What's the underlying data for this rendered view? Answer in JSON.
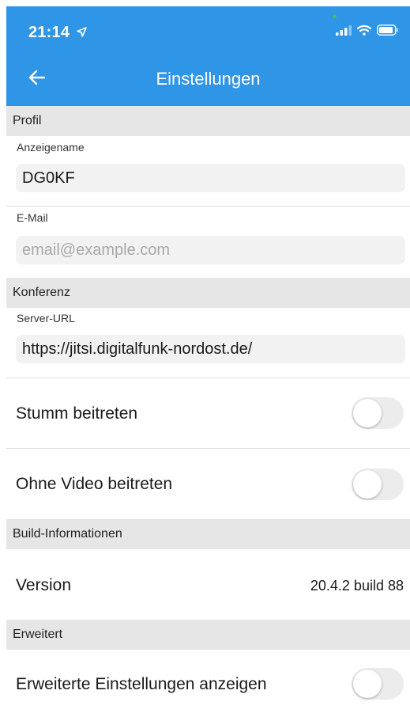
{
  "status_bar": {
    "time": "21:14",
    "icons": [
      "location-arrow-icon",
      "signal-icon",
      "wifi-icon",
      "battery-icon"
    ]
  },
  "nav": {
    "title": "Einstellungen",
    "back_icon": "arrow-left-icon"
  },
  "sections": {
    "profil": {
      "header": "Profil",
      "display_name_label": "Anzeigename",
      "display_name_value": "DG0KF",
      "email_label": "E-Mail",
      "email_placeholder": "email@example.com"
    },
    "konferenz": {
      "header": "Konferenz",
      "server_url_label": "Server-URL",
      "server_url_value": "https://jitsi.digitalfunk-nordost.de/",
      "mute_label": "Stumm beitreten",
      "mute_on": false,
      "no_video_label": "Ohne Video beitreten",
      "no_video_on": false
    },
    "build": {
      "header": "Build-Informationen",
      "version_label": "Version",
      "version_value": "20.4.2 build 88"
    },
    "erweitert": {
      "header": "Erweitert",
      "advanced_label": "Erweiterte Einstellungen anzeigen",
      "advanced_on": false
    }
  },
  "colors": {
    "header_bg": "#2f95e6",
    "section_bg": "#e6e6e6",
    "field_bg": "#f2f2f2",
    "toggle_off": "#ececec"
  }
}
